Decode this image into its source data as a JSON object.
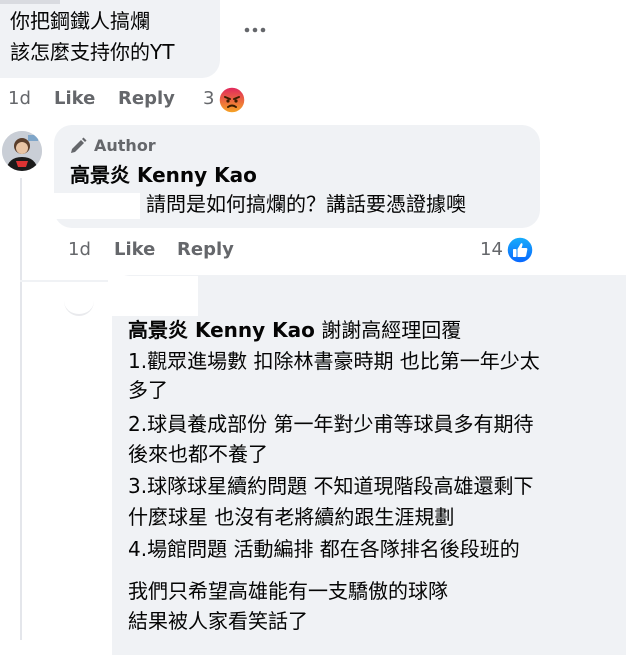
{
  "comment1": {
    "lines": [
      "你把鋼鐵人搞爛",
      "該怎麼支持你的YT"
    ],
    "time": "1d",
    "like_label": "Like",
    "reply_label": "Reply",
    "reaction_count": "3",
    "reaction_icon": "angry-reaction-icon",
    "more_icon": "more-options-icon"
  },
  "comment2": {
    "badge": "Author",
    "author": "高景炎 Kenny Kao",
    "text": "請問是如何搞爛的？講話要憑證據噢",
    "time": "1d",
    "like_label": "Like",
    "reply_label": "Reply",
    "reaction_count": "14",
    "reaction_icon": "like-reaction-icon"
  },
  "comment3": {
    "mention": "高景炎 Kenny Kao",
    "first_line": " 謝謝高經理回覆",
    "lines": [
      "1.觀眾進場數 扣除林書豪時期 也比第一年少太",
      "多了",
      "2.球員養成部份 第一年對少甫等球員多有期待",
      "後來也都不養了",
      "3.球隊球星續約問題 不知道現階段高雄還剩下",
      "什麼球星 也沒有老將續約跟生涯規劃",
      "4.場館問題 活動編排 都在各隊排名後段班的"
    ],
    "closing": [
      "我們只希望高雄能有一支驕傲的球隊",
      "結果被人家看笑話了"
    ]
  },
  "colors": {
    "bubble": "#f0f2f5",
    "meta": "#65676b",
    "like_blue": "#1877f2",
    "angry": "#e9710f"
  }
}
